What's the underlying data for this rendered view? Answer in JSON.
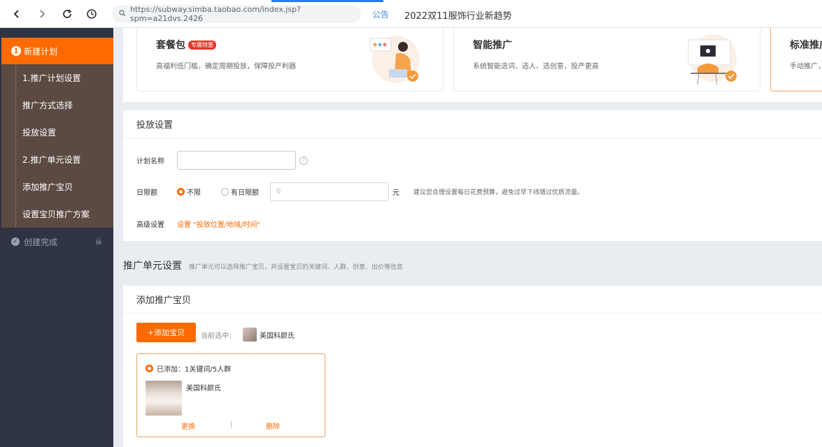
{
  "browser": {
    "url": "https://subway.simba.taobao.com/index.jsp?spm=a21dvs.2426",
    "announce": "公告",
    "headline": "2022双11服饰行业新趋势"
  },
  "sidebar": {
    "step1": {
      "num": "1",
      "label": "新建计划"
    },
    "items": [
      {
        "label": "1.推广计划设置"
      },
      {
        "label": "推广方式选择"
      },
      {
        "label": "投放设置"
      },
      {
        "label": "2.推广单元设置"
      },
      {
        "label": "添加推广宝贝"
      },
      {
        "label": "设置宝贝推广方案"
      }
    ],
    "done": {
      "label": "创建完成"
    }
  },
  "plans": [
    {
      "title": "套餐包",
      "badge": "专属特惠",
      "desc": "高福利低门槛，确定周期投放，保障投产利器"
    },
    {
      "title": "智能推广",
      "desc": "系统智能选词、选人、选创意，投产更高"
    },
    {
      "title": "标准推广",
      "desc": "手动推广，"
    }
  ],
  "delivery": {
    "title": "投放设置",
    "plan_name_label": "计划名称",
    "plan_name_value": "",
    "daily_limit_label": "日限额",
    "opt_unlimited": "不限",
    "opt_limited": "有日限额",
    "budget_placeholder": "0",
    "unit": "元",
    "tip": "建议您合理设置每日花费预算，避免过早下线错过优质流量。",
    "advanced_label": "高级设置",
    "advanced_link": "设置 \"投放位置/地域/时间\""
  },
  "unit_section": {
    "title": "推广单元设置",
    "desc": "推广单元可以选择推广宝贝，并设置宝贝的关键词、人群、创意、出价等信息"
  },
  "add_items": {
    "title": "添加推广宝贝",
    "add_button": "+添加宝贝",
    "current_label": "当前选中：",
    "current_name": "美国科颜氏",
    "item": {
      "status": "已添加：1关键词/5人群",
      "name": "美国科颜氏",
      "replace": "更换",
      "delete": "删除"
    }
  },
  "colors": {
    "accent": "#ff6a00",
    "sidebar_bg": "#2f3443",
    "link_blue": "#4a90e2"
  }
}
